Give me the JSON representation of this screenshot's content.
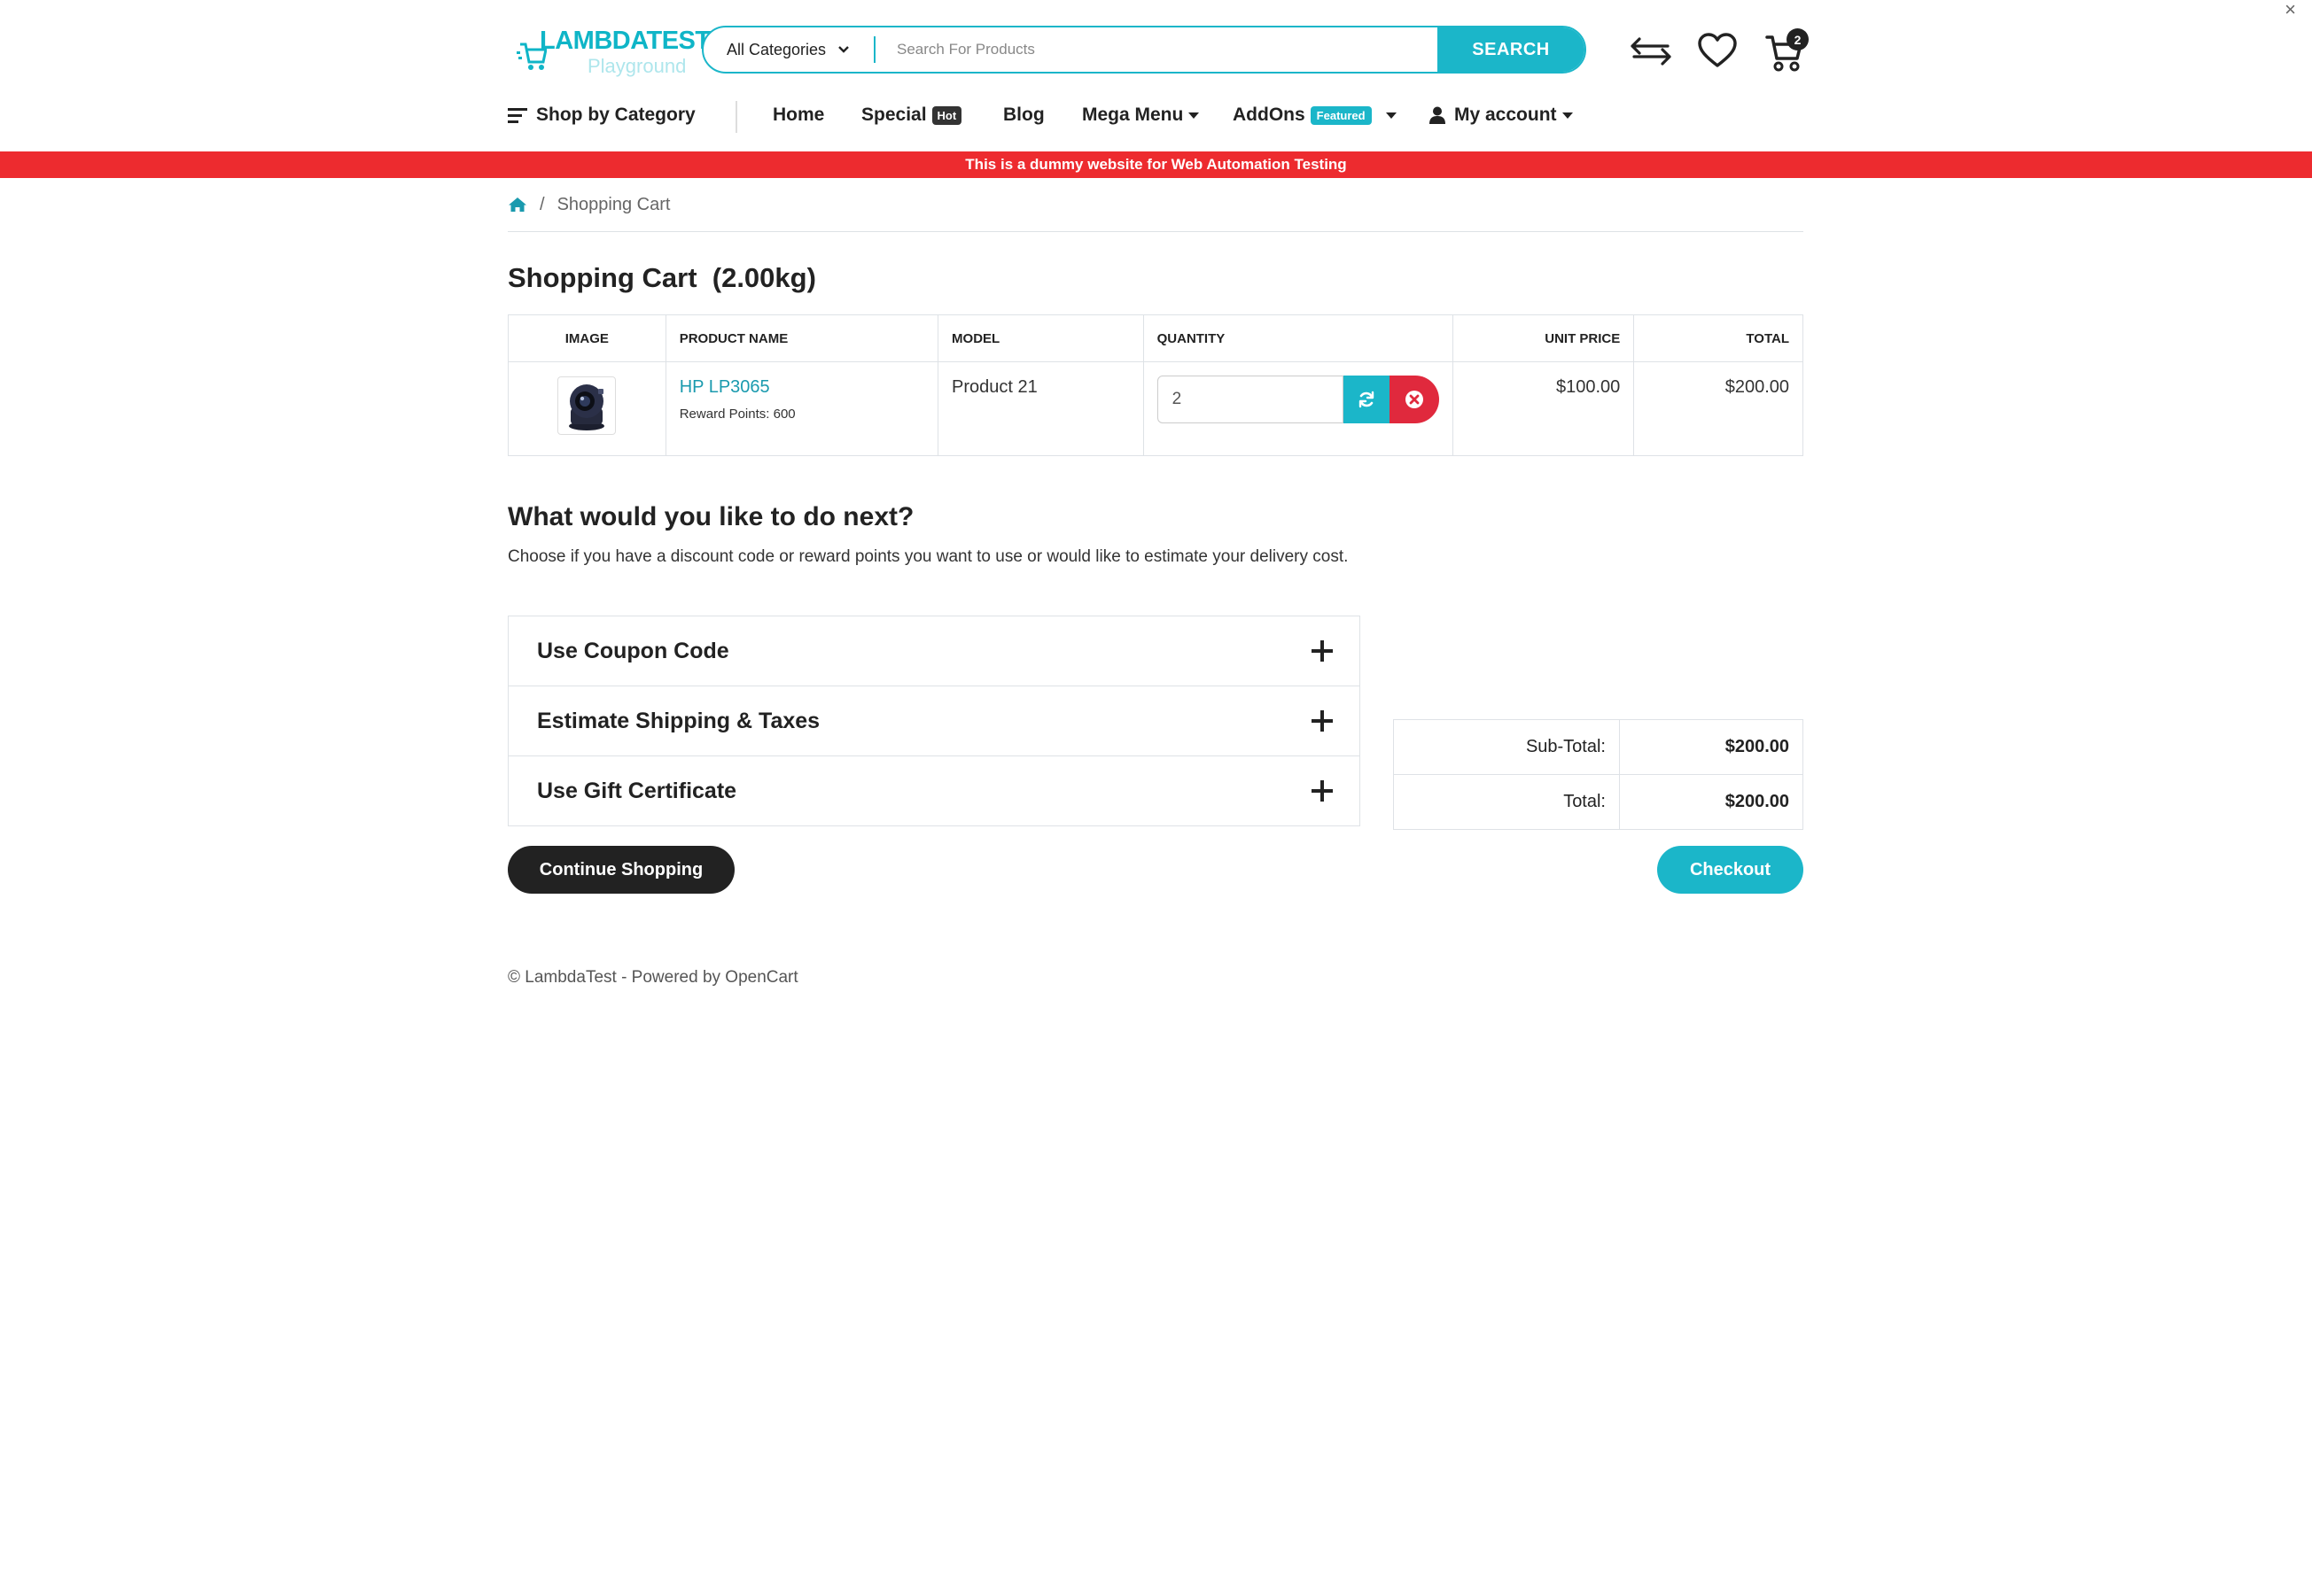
{
  "window": {
    "close_glyph": "×"
  },
  "header": {
    "logo": {
      "main": "LAMBDATEST",
      "sub": "Playground"
    },
    "search": {
      "category_label": "All Categories",
      "placeholder": "Search For Products",
      "button_label": "SEARCH"
    },
    "icons": [
      "compare-arrows-icon",
      "heart-icon",
      "cart-icon"
    ],
    "cart_count": "2"
  },
  "nav": {
    "shop_by_category": "Shop by Category",
    "home": "Home",
    "special": "Special",
    "special_badge": "Hot",
    "blog": "Blog",
    "mega_menu": "Mega Menu",
    "addons": "AddOns",
    "addons_badge": "Featured",
    "my_account": "My account"
  },
  "notice": "This is a dummy website for Web Automation Testing",
  "breadcrumb": {
    "separator": "/",
    "current": "Shopping Cart"
  },
  "cart": {
    "title": "Shopping Cart  (2.00kg)",
    "columns": {
      "image": "Image",
      "product_name": "Product Name",
      "model": "Model",
      "quantity": "Quantity",
      "unit_price": "Unit Price",
      "total": "Total"
    },
    "items": [
      {
        "name": "HP LP3065",
        "reward": "Reward Points: 600",
        "model": "Product 21",
        "quantity": "2",
        "unit_price": "$100.00",
        "total": "$200.00"
      }
    ]
  },
  "next": {
    "title": "What would you like to do next?",
    "description": "Choose if you have a discount code or reward points you want to use or would like to estimate your delivery cost.",
    "panels": [
      "Use Coupon Code",
      "Estimate Shipping & Taxes",
      "Use Gift Certificate"
    ]
  },
  "totals": {
    "subtotal_label": "Sub-Total:",
    "subtotal_value": "$200.00",
    "total_label": "Total:",
    "total_value": "$200.00"
  },
  "buttons": {
    "continue": "Continue Shopping",
    "checkout": "Checkout"
  },
  "footer": "© LambdaTest - Powered by OpenCart",
  "colors": {
    "accent": "#1bb6c9",
    "danger": "#e0293d",
    "notice_bar": "#ed2b2f",
    "dark": "#222222"
  }
}
